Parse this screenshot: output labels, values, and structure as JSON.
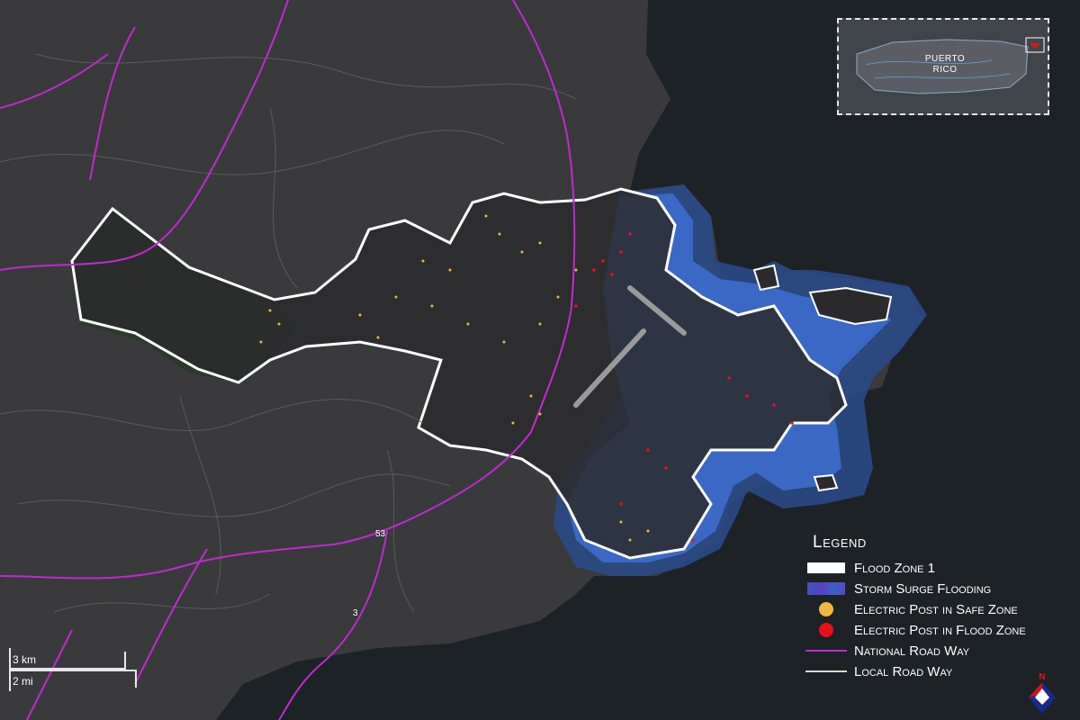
{
  "map": {
    "inset": {
      "region_label_line1": "PUERTO",
      "region_label_line2": "RICO"
    },
    "legend": {
      "title": "Legend",
      "items": [
        {
          "label": "Flood Zone 1",
          "symbol": "white-bar",
          "color": "#ffffff"
        },
        {
          "label": "Storm Surge Flooding",
          "symbol": "blue-bar",
          "color": "#4a4fc4"
        },
        {
          "label": "Electric Post in Safe Zone",
          "symbol": "dot",
          "color": "#f0b840"
        },
        {
          "label": "Electric Post in Flood Zone",
          "symbol": "dot",
          "color": "#e8101a"
        },
        {
          "label": "National Road Way",
          "symbol": "line",
          "color": "#c02ad0"
        },
        {
          "label": "Local Road Way",
          "symbol": "line",
          "color": "#d8d8d8"
        }
      ]
    },
    "scale": {
      "km_label": "3 km",
      "mi_label": "2 mi"
    },
    "road_labels": {
      "route_53": "53",
      "route_3": "3"
    },
    "compass": {
      "north_label": "N"
    },
    "colors": {
      "land": "#3a3a3d",
      "water": "#1d2226",
      "flood_zone_fill": "#2b2b2e",
      "storm_surge": "#3d6fd0",
      "halo": "#2a4a86"
    }
  }
}
